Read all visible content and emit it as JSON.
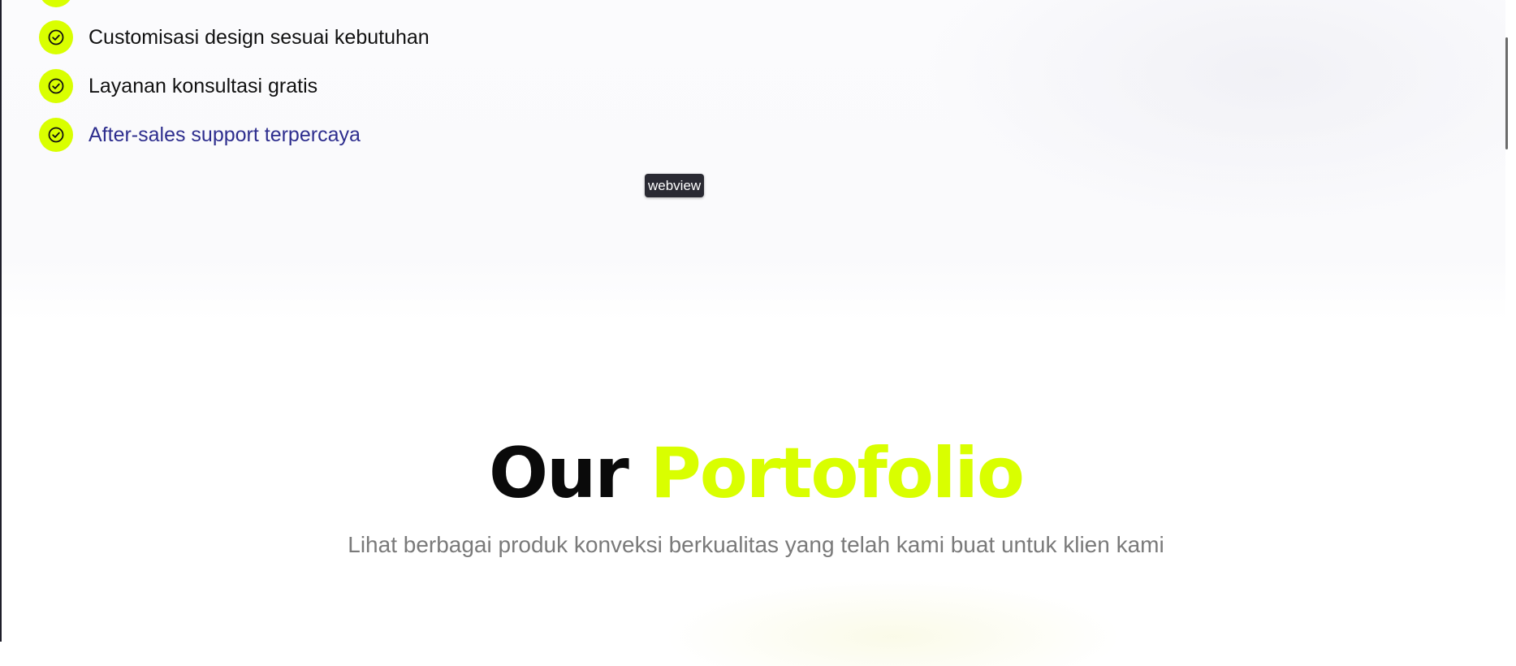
{
  "features": {
    "items": [
      {
        "label": "Customisasi design sesuai kebutuhan",
        "icon": "check-circle-icon"
      },
      {
        "label": "Layanan konsultasi gratis",
        "icon": "check-circle-icon"
      },
      {
        "label": "After-sales support terpercaya",
        "icon": "check-circle-icon",
        "link": true
      }
    ]
  },
  "tooltip": {
    "text": "webview"
  },
  "portfolio": {
    "title_part1": "Our",
    "title_part2": "Portofolio",
    "subtitle": "Lihat berbagai produk konveksi berkualitas yang telah kami buat untuk klien kami"
  },
  "colors": {
    "accent": "#d9ff00",
    "text_dark": "#111111",
    "link": "#2e2e8e",
    "muted": "#7a7a7a"
  }
}
